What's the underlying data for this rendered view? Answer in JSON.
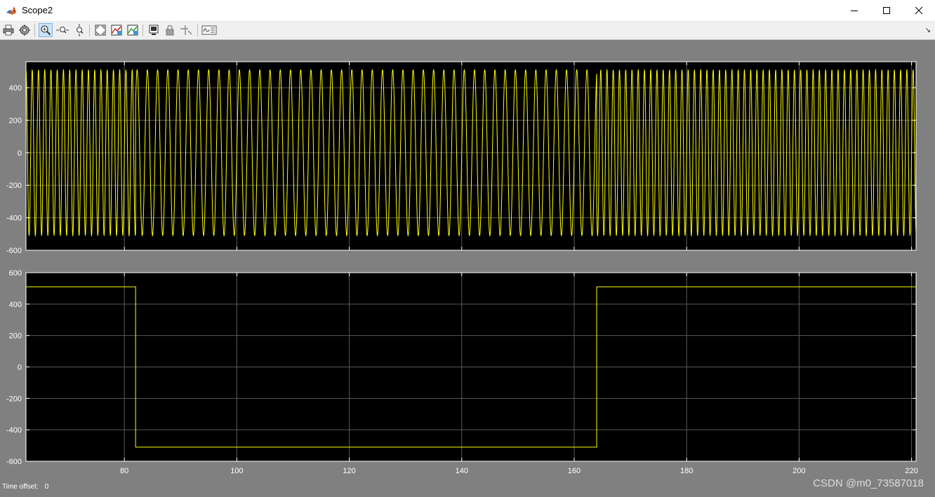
{
  "window": {
    "title": "Scope2"
  },
  "toolbar": {
    "buttons": [
      {
        "name": "print-icon"
      },
      {
        "name": "parameters-gear-icon"
      },
      {
        "name": "zoom-in-icon",
        "active": true
      },
      {
        "name": "zoom-x-icon"
      },
      {
        "name": "zoom-y-icon"
      },
      {
        "name": "autoscale-icon"
      },
      {
        "name": "save-axes-settings-icon"
      },
      {
        "name": "restore-axes-settings-icon"
      },
      {
        "name": "floating-scope-icon"
      },
      {
        "name": "lock-axes-icon"
      },
      {
        "name": "signal-selection-icon"
      },
      {
        "name": "legend-icon"
      }
    ],
    "dock_symbol": "↘"
  },
  "chart_data": [
    {
      "type": "line",
      "series": [
        {
          "signal": "sine",
          "amplitude": 510,
          "segments": [
            {
              "x_start": 62.5,
              "x_end": 82,
              "frequency_hz": 0.9
            },
            {
              "x_start": 82,
              "x_end": 164,
              "frequency_hz": 0.55
            },
            {
              "x_start": 164,
              "x_end": 220.8,
              "frequency_hz": 0.9
            }
          ]
        }
      ],
      "xlim": [
        62.5,
        220.8
      ],
      "ylim": [
        -600,
        560
      ],
      "yticks": [
        -600,
        -400,
        -200,
        0,
        200,
        400
      ],
      "xticks": [
        80,
        100,
        120,
        140,
        160,
        180,
        200,
        220
      ],
      "xtick_labels_shown": false,
      "grid": true,
      "line_color": "#ffff00",
      "background": "#000000"
    },
    {
      "type": "line",
      "series": [
        {
          "x": [
            62.5,
            82,
            82,
            164,
            164,
            220.8
          ],
          "y": [
            510,
            510,
            -510,
            -510,
            510,
            510
          ]
        }
      ],
      "xlim": [
        62.5,
        220.8
      ],
      "ylim": [
        -600,
        600
      ],
      "yticks": [
        -600,
        -400,
        -200,
        0,
        200,
        400,
        600
      ],
      "xticks": [
        80,
        100,
        120,
        140,
        160,
        180,
        200,
        220
      ],
      "xtick_labels_shown": true,
      "grid": true,
      "line_color": "#ffff00",
      "background": "#000000"
    }
  ],
  "status": {
    "time_offset_label": "Time offset:",
    "time_offset_value": "0"
  },
  "watermark": "CSDN @m0_73587018"
}
